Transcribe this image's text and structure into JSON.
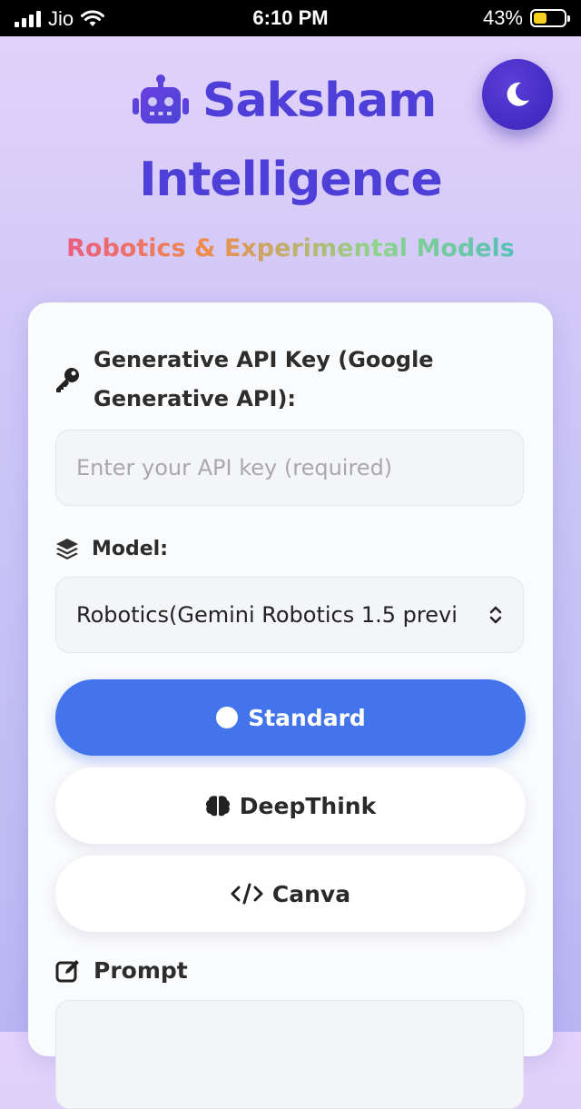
{
  "status_bar": {
    "carrier": "Jio",
    "time": "6:10 PM",
    "battery_percent": "43%",
    "battery_level": 0.43,
    "signal_icon": "signal-bars-icon",
    "wifi_icon": "wifi-icon"
  },
  "header": {
    "title_line1": "Saksham",
    "title_line2": "Intelligence",
    "subtitle": "Robotics & Experimental Models",
    "logo_icon": "robot-icon",
    "theme_toggle_icon": "moon-icon"
  },
  "form": {
    "api_key_label": "Generative API Key (Google Generative API):",
    "api_key_placeholder": "Enter your API key (required)",
    "model_label": "Model:",
    "model_selected": "Robotics(Gemini Robotics 1.5 previ",
    "modes": {
      "standard": "Standard",
      "deepthink": "DeepThink",
      "canva": "Canva"
    },
    "prompt_label": "Prompt"
  },
  "colors": {
    "accent": "#4d3fd8",
    "primary_button": "#4474ec",
    "moon_button": "#3a22b8"
  }
}
